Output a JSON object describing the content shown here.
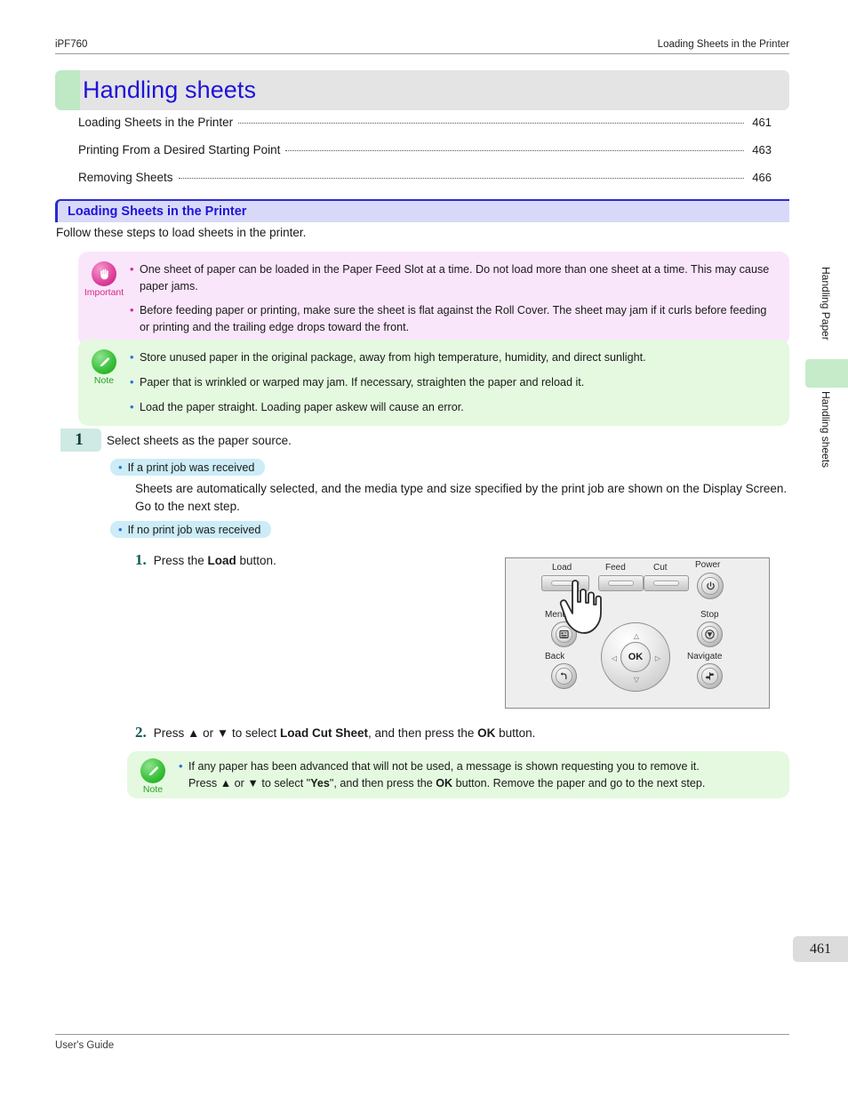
{
  "header": {
    "model": "iPF760",
    "running_head": "Loading Sheets in the Printer"
  },
  "chapter": {
    "title": "Handling sheets"
  },
  "toc": {
    "entries": [
      {
        "label": "Loading Sheets in the Printer",
        "page": "461"
      },
      {
        "label": "Printing From a Desired Starting Point",
        "page": "463"
      },
      {
        "label": "Removing Sheets",
        "page": "466"
      }
    ]
  },
  "section": {
    "heading": "Loading Sheets in the Printer",
    "intro": "Follow these steps to load sheets in the printer."
  },
  "important_box": {
    "icon": "hand-stop-icon",
    "label": "Important",
    "items": [
      "One sheet of paper can be loaded in the Paper Feed Slot at a time. Do not load more than one sheet at a time. This may cause paper jams.",
      "Before feeding paper or printing, make sure the sheet is flat against the Roll Cover. The sheet may jam if it curls before feeding or printing and the trailing edge drops toward the front."
    ]
  },
  "note_box_1": {
    "icon": "pencil-icon",
    "label": "Note",
    "items": [
      "Store unused paper in the original package, away from high temperature, humidity, and direct sunlight.",
      "Paper that is wrinkled or warped may jam. If necessary, straighten the paper and reload it.",
      "Load the paper straight. Loading paper askew will cause an error."
    ]
  },
  "step1": {
    "number": "1",
    "text": "Select sheets as the paper source.",
    "subhead_a": "If a print job was received",
    "subbody_a": "Sheets are automatically selected, and the media type and size specified by the print job are shown on the Display Screen. Go to the next step.",
    "subhead_b": "If no print job was received"
  },
  "substeps": [
    {
      "number": "1.",
      "parts": [
        {
          "text": "Press the ",
          "bold": false
        },
        {
          "text": "Load",
          "bold": true
        },
        {
          "text": " button.",
          "bold": false
        }
      ]
    },
    {
      "number": "2.",
      "parts": [
        {
          "text": "Press ▲ or ▼ to select ",
          "bold": false
        },
        {
          "text": "Load Cut Sheet",
          "bold": true
        },
        {
          "text": ", and then press the ",
          "bold": false
        },
        {
          "text": "OK",
          "bold": true
        },
        {
          "text": " button.",
          "bold": false
        }
      ]
    }
  ],
  "note_box_2": {
    "icon": "pencil-icon",
    "label": "Note",
    "line1": "If any paper has been advanced that will not be used, a message is shown requesting you to remove it.",
    "line2_parts": [
      {
        "text": "Press ▲ or ▼ to select \"",
        "bold": false
      },
      {
        "text": "Yes",
        "bold": true
      },
      {
        "text": "\", and then press the ",
        "bold": false
      },
      {
        "text": "OK",
        "bold": true
      },
      {
        "text": " button. Remove the paper and go to the next step.",
        "bold": false
      }
    ]
  },
  "panel_figure": {
    "caption": "printer-control-panel",
    "buttons": [
      {
        "name": "load-button",
        "label": "Load"
      },
      {
        "name": "feed-button",
        "label": "Feed"
      },
      {
        "name": "cut-button",
        "label": "Cut"
      },
      {
        "name": "power-button",
        "label": "Power"
      },
      {
        "name": "menu-button",
        "label": "Menu"
      },
      {
        "name": "back-button",
        "label": "Back"
      },
      {
        "name": "stop-button",
        "label": "Stop"
      },
      {
        "name": "navigate-button",
        "label": "Navigate"
      },
      {
        "name": "ok-button",
        "label": "OK"
      }
    ]
  },
  "side_tabs": {
    "tab1": "Handling Paper",
    "tab2": "Handling sheets"
  },
  "page_number": "461",
  "footer": {
    "text": "User's Guide"
  },
  "colors": {
    "chapter_title": "#1f13d8",
    "section_heading": "#1f13d8",
    "important_bg": "#fae6fb",
    "note_bg": "#e4f9df",
    "subhead_bg": "#ccecf7",
    "step_badge_bg": "#cfe9e4",
    "side_marker": "#c6ebc9"
  }
}
